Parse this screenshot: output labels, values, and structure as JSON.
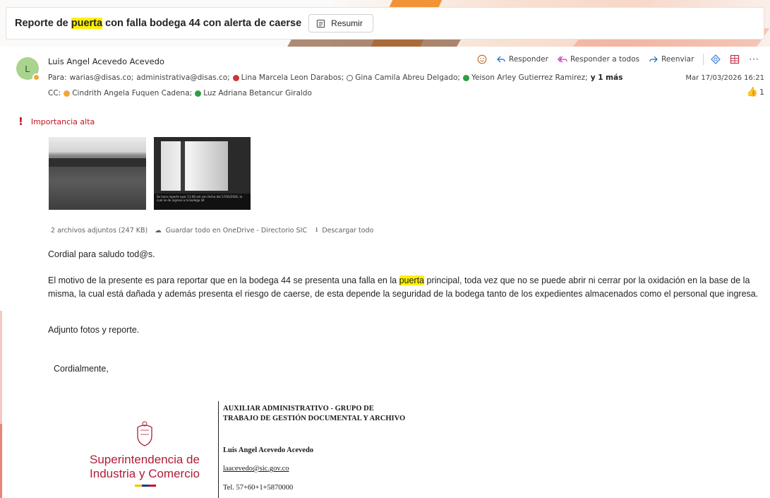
{
  "subject": {
    "before": "Reporte de ",
    "highlight": "puerta",
    "after": " con falla bodega 44 con alerta de caerse",
    "summarize_label": "Resumir"
  },
  "sender": {
    "initial": "L",
    "name": "Luis Angel Acevedo Acevedo",
    "to_label": "Para:",
    "to": [
      {
        "name": "warias@disas.co;",
        "status": "none"
      },
      {
        "name": "administrativa@disas.co;",
        "status": "none"
      },
      {
        "name": "Lina Marcela Leon Darabos;",
        "status": "red"
      },
      {
        "name": "Gina Camila Abreu Delgado;",
        "status": "away"
      },
      {
        "name": "Yeison Arley Gutierrez Ramirez;",
        "status": "green"
      }
    ],
    "more": "y 1 más",
    "cc_label": "CC:",
    "cc": [
      {
        "name": "Cindrith Angela Fuquen Cadena;",
        "status": "orange"
      },
      {
        "name": "Luz Adriana Betancur Giraldo",
        "status": "green"
      }
    ],
    "date": "Mar 17/03/2026 16:21",
    "like_count": "1"
  },
  "actions": {
    "reply": "Responder",
    "reply_all": "Responder a todos",
    "forward": "Reenviar"
  },
  "importance": "Importancia alta",
  "attachments": {
    "summary": "2 archivos adjuntos (247 KB)",
    "save": "Guardar todo en OneDrive - Directorio SIC",
    "download": "Descargar todo",
    "thumb2_caption": "Se hace reporte ayer 11:06 am con fecha del 17/03/2026, la cual se de ingreso a la bodega 44"
  },
  "body": {
    "greeting": "Cordial para saludo tod@s.",
    "p2_before": "El motivo de la presente es para reportar que en la bodega 44 se presenta una falla en la ",
    "p2_highlight": "puerta",
    "p2_after": " principal, toda vez que no se puede abrir ni cerrar por la oxidación en la base de la misma, la cual está dañada y además presenta el riesgo de caerse, de esta depende la seguridad de la bodega tanto de los expedientes almacenados como el personal que ingresa.",
    "p3": "Adjunto fotos y reporte.",
    "closing": "Cordialmente,"
  },
  "signature": {
    "org_line1": "Superintendencia de",
    "org_line2": "Industria y Comercio",
    "title": "AUXILIAR ADMINISTRATIVO - GRUPO DE TRABAJO DE GESTIÓN DOCUMENTAL Y ARCHIVO",
    "person": "Luis Angel Acevedo Acevedo",
    "email": "laacevedo@sic.gov.co",
    "tel": "Tel. 57+60+1+5870000"
  },
  "colors": {
    "highlight": "#fff100",
    "importance": "#c50f1f",
    "brand": "#b01c38"
  }
}
